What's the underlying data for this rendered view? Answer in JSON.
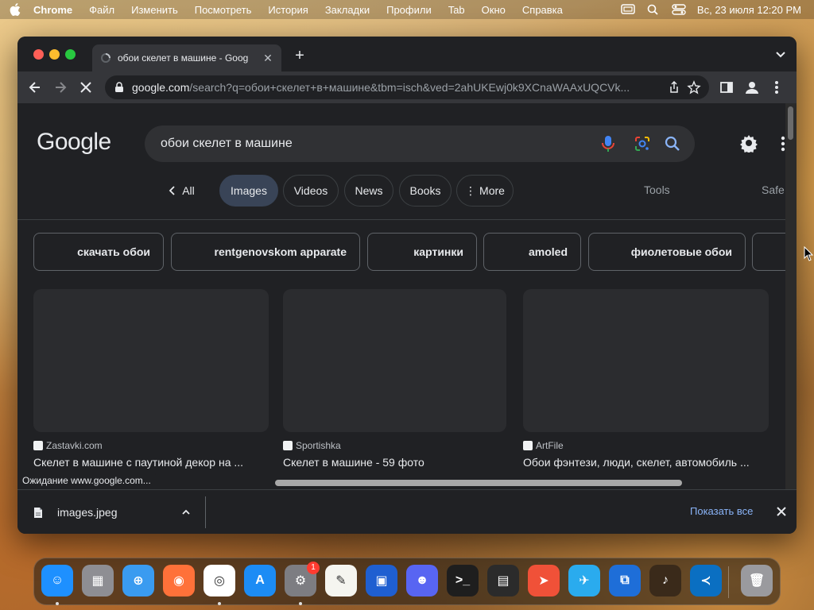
{
  "menubar": {
    "app_name": "Chrome",
    "items": [
      "Файл",
      "Изменить",
      "Посмотреть",
      "История",
      "Закладки",
      "Профили",
      "Tab",
      "Окно",
      "Справка"
    ],
    "datetime": "Вс, 23 июля  12:20 PM"
  },
  "tab": {
    "title": "обои скелет в машине - Goog"
  },
  "address": {
    "host": "google.com",
    "path": "/search?q=обои+скелет+в+машине&tbm=isch&ved=2ahUKEwj0k9XCnaWAAxUQCVk..."
  },
  "google": {
    "logo": "Google",
    "query": "обои скелет в машине",
    "filters": {
      "all": "All",
      "images": "Images",
      "videos": "Videos",
      "news": "News",
      "books": "Books",
      "more": "More",
      "tools": "Tools",
      "safesearch": "Safe"
    },
    "related": [
      "скачать обои",
      "rentgenovskom apparate",
      "картинки",
      "amoled",
      "фиолетовые обои"
    ],
    "results": [
      {
        "source": "Zastavki.com",
        "title": "Скелет в машине с паутиной декор на ..."
      },
      {
        "source": "Sportishka",
        "title": "Скелет в машине - 59 фото"
      },
      {
        "source": "ArtFile",
        "title": "Обои фэнтези, люди, скелет, автомобиль ..."
      }
    ]
  },
  "status": "Ожидание www.google.com...",
  "download": {
    "filename": "images.jpeg",
    "show_all": "Показать все"
  },
  "dock": {
    "apps": [
      {
        "name": "Finder",
        "icon": "finder-icon",
        "color": "#1e90ff"
      },
      {
        "name": "Launchpad",
        "icon": "launchpad-icon",
        "color": "#8e8e93"
      },
      {
        "name": "Safari",
        "icon": "safari-icon",
        "color": "#3a9bf0"
      },
      {
        "name": "Firefox",
        "icon": "firefox-icon",
        "color": "#ff7139"
      },
      {
        "name": "Chrome",
        "icon": "chrome-icon",
        "color": "#ffffff"
      },
      {
        "name": "App Store",
        "icon": "app-store-icon",
        "color": "#1c8cf5"
      },
      {
        "name": "System Settings",
        "icon": "settings-icon",
        "color": "#7d7d82",
        "badge": "1"
      },
      {
        "name": "TextEdit",
        "icon": "textedit-icon",
        "color": "#f5f5f0"
      },
      {
        "name": "Simulator",
        "icon": "simulator-icon",
        "color": "#1f5fd1"
      },
      {
        "name": "Discord",
        "icon": "discord-icon",
        "color": "#5865f2"
      },
      {
        "name": "Terminal",
        "icon": "terminal-icon",
        "color": "#1e1e1e"
      },
      {
        "name": "Console",
        "icon": "console-icon",
        "color": "#2b2b2b"
      },
      {
        "name": "Swift Playgrounds",
        "icon": "swift-icon",
        "color": "#f05138"
      },
      {
        "name": "Telegram",
        "icon": "telegram-icon",
        "color": "#2aabee"
      },
      {
        "name": "Network Utility",
        "icon": "network-icon",
        "color": "#1e6ed8"
      },
      {
        "name": "GarageBand",
        "icon": "garageband-icon",
        "color": "#3a2a1a"
      },
      {
        "name": "VS Code",
        "icon": "vscode-icon",
        "color": "#0a6fc2"
      },
      {
        "name": "Trash",
        "icon": "trash-icon",
        "color": "#9a9a9e"
      }
    ]
  }
}
